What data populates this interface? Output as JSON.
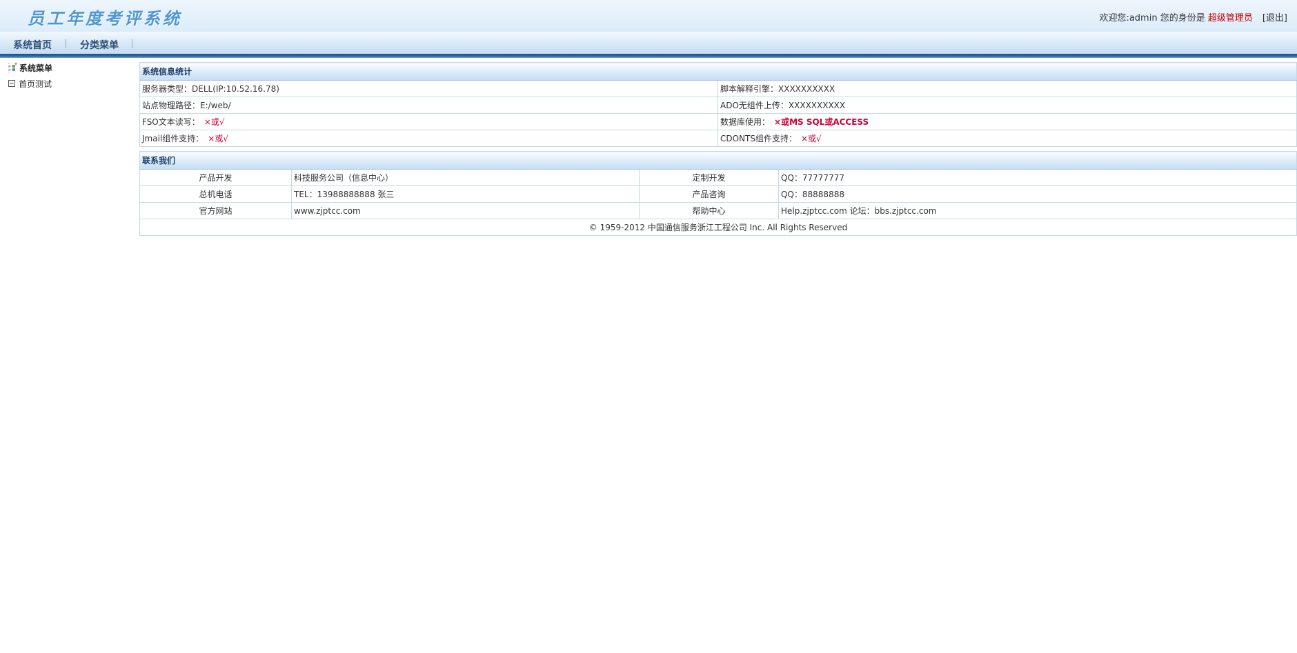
{
  "header": {
    "app_title": "员工年度考评系统",
    "welcome_prefix": "欢迎您:",
    "username": "admin",
    "identity_prefix": " 您的身份是 ",
    "role": "超级管理员",
    "logout": "[退出]"
  },
  "nav": {
    "items": [
      {
        "label": "系统首页"
      },
      {
        "label": "分类菜单"
      }
    ]
  },
  "sidebar": {
    "root_label": "系统菜单",
    "children": [
      {
        "label": "首页测试"
      }
    ]
  },
  "sysinfo": {
    "title": "系统信息统计",
    "rows": [
      [
        {
          "label": "服务器类型：",
          "value": "DELL(IP:10.52.16.78)"
        },
        {
          "label": "脚本解释引擎：",
          "value": "XXXXXXXXXX"
        }
      ],
      [
        {
          "label": "站点物理路径：",
          "value": "E:/web/"
        },
        {
          "label": "ADO无组件上传：",
          "value": "XXXXXXXXXX"
        }
      ],
      [
        {
          "label": "FSO文本读写：",
          "value": "×或√"
        },
        {
          "label": "数据库使用：",
          "value": "×或MS SQL或ACCESS"
        }
      ],
      [
        {
          "label": "Jmail组件支持：",
          "value": "×或√"
        },
        {
          "label": "CDONTS组件支持：",
          "value": "×或√"
        }
      ]
    ]
  },
  "contact": {
    "title": "联系我们",
    "rows": [
      {
        "l1": "产品开发",
        "v1": "科技服务公司（信息中心）",
        "l2": "定制开发",
        "v2": "QQ：77777777"
      },
      {
        "l1": "总机电话",
        "v1": "TEL：13988888888 张三",
        "l2": "产品咨询",
        "v2": "QQ：88888888"
      },
      {
        "l1": "官方网站",
        "v1": "www.zjptcc.com",
        "l2": "帮助中心",
        "v2": "Help.zjptcc.com 论坛：bbs.zjptcc.com"
      }
    ],
    "copyright": "© 1959-2012 中国通信服务浙江工程公司 Inc. All Rights Reserved"
  },
  "colors": {
    "accent_blue": "#2c6aa8",
    "title_blue": "#4f97cf",
    "role_red": "#c00000",
    "mark_red": "#cc0033"
  }
}
